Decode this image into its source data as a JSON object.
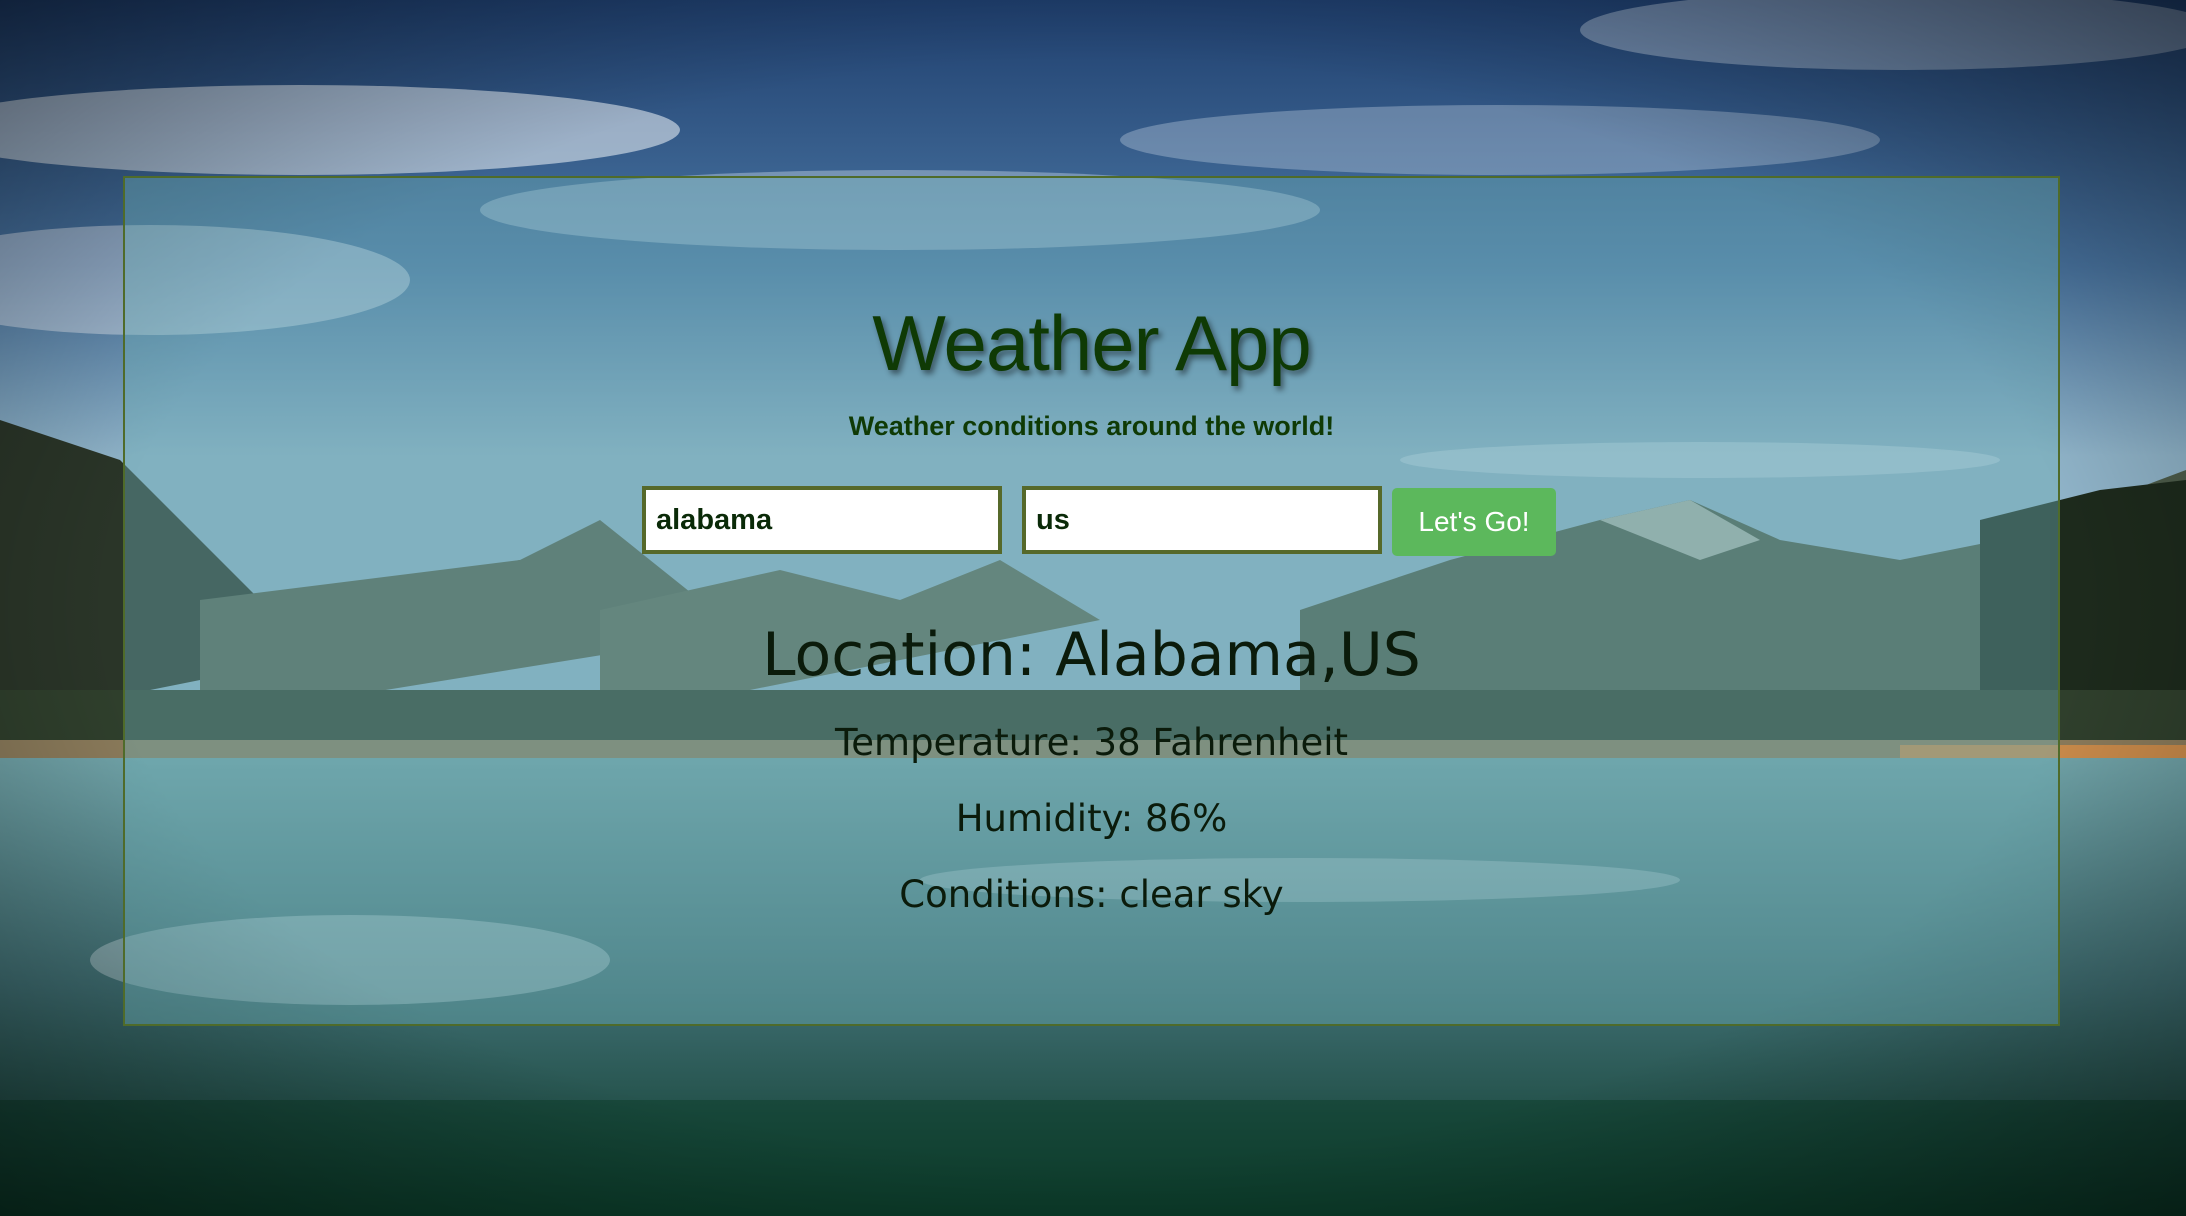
{
  "app": {
    "title": "Weather App",
    "subtitle": "Weather conditions around the world!"
  },
  "form": {
    "city_value": "alabama",
    "country_value": "us",
    "submit_label": "Let's Go!"
  },
  "result": {
    "location": "Location: Alabama,US",
    "temperature": "Temperature: 38 Fahrenheit",
    "humidity": "Humidity: 86%",
    "conditions": "Conditions: clear sky"
  },
  "colors": {
    "title": "#0f3a05",
    "button": "#5cb85c",
    "field_border": "#56692a",
    "panel_border": "#4f6b2a"
  }
}
